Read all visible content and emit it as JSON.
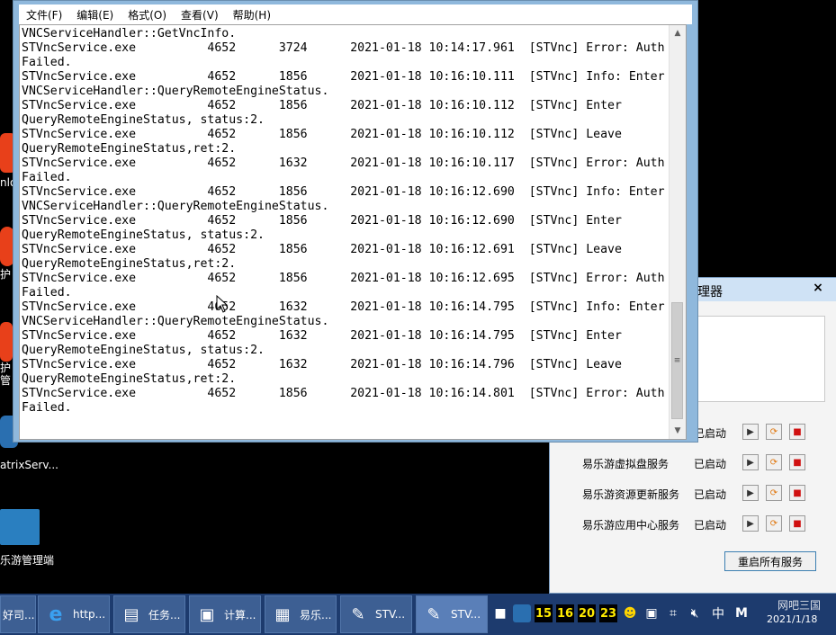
{
  "desktop": {
    "icons": [
      {
        "label": "nlo",
        "color": "#e8401a"
      },
      {
        "label": "护",
        "color": "#e8401a"
      },
      {
        "label": "护\n管",
        "color": "#e8401a"
      },
      {
        "label": "atrixServ...",
        "color": "#2a6fb0"
      },
      {
        "label": "乐游管理端",
        "color": "#2a7fc0"
      }
    ]
  },
  "notepad": {
    "menu": [
      "文件(F)",
      "编辑(E)",
      "格式(O)",
      "查看(V)",
      "帮助(H)"
    ],
    "log_lines": [
      "VNCServiceHandler::GetVncInfo.",
      "STVncService.exe          4652      3724      2021-01-18 10:14:17.961  [STVnc] Error: Auth",
      "Failed.",
      "STVncService.exe          4652      1856      2021-01-18 10:16:10.111  [STVnc] Info: Enter",
      "VNCServiceHandler::QueryRemoteEngineStatus.",
      "STVncService.exe          4652      1856      2021-01-18 10:16:10.112  [STVnc] Enter",
      "QueryRemoteEngineStatus, status:2.",
      "STVncService.exe          4652      1856      2021-01-18 10:16:10.112  [STVnc] Leave",
      "QueryRemoteEngineStatus,ret:2.",
      "STVncService.exe          4652      1632      2021-01-18 10:16:10.117  [STVnc] Error: Auth",
      "Failed.",
      "STVncService.exe          4652      1856      2021-01-18 10:16:12.690  [STVnc] Info: Enter",
      "VNCServiceHandler::QueryRemoteEngineStatus.",
      "STVncService.exe          4652      1856      2021-01-18 10:16:12.690  [STVnc] Enter",
      "QueryRemoteEngineStatus, status:2.",
      "STVncService.exe          4652      1856      2021-01-18 10:16:12.691  [STVnc] Leave",
      "QueryRemoteEngineStatus,ret:2.",
      "STVncService.exe          4652      1856      2021-01-18 10:16:12.695  [STVnc] Error: Auth",
      "Failed.",
      "STVncService.exe          4652      1632      2021-01-18 10:16:14.795  [STVnc] Info: Enter",
      "VNCServiceHandler::QueryRemoteEngineStatus.",
      "STVncService.exe          4652      1632      2021-01-18 10:16:14.795  [STVnc] Enter",
      "QueryRemoteEngineStatus, status:2.",
      "STVncService.exe          4652      1632      2021-01-18 10:16:14.796  [STVnc] Leave",
      "QueryRemoteEngineStatus,ret:2.",
      "STVncService.exe          4652      1856      2021-01-18 10:16:14.801  [STVnc] Error: Auth",
      "Failed."
    ]
  },
  "service_manager": {
    "title": "理器",
    "close": "×",
    "services": [
      {
        "name": "",
        "status": "已启动"
      },
      {
        "name": "易乐游虚拟盘服务",
        "status": "已启动"
      },
      {
        "name": "易乐游资源更新服务",
        "status": "已启动"
      },
      {
        "name": "易乐游应用中心服务",
        "status": "已启动"
      }
    ],
    "restart_all": "重启所有服务"
  },
  "taskbar": {
    "tasks": [
      {
        "label": "好司...",
        "icon": ""
      },
      {
        "label": "http...",
        "icon": "e"
      },
      {
        "label": "任务...",
        "icon": "▤"
      },
      {
        "label": "计算...",
        "icon": "▣"
      },
      {
        "label": "易乐...",
        "icon": "▦"
      },
      {
        "label": "STV...",
        "icon": "✎"
      },
      {
        "label": "STV...",
        "icon": "✎"
      }
    ],
    "tray_numbers": [
      "15",
      "16",
      "20",
      "23"
    ],
    "tray_ime": "中",
    "tray_m": "M",
    "clock_date": "2021/1/18",
    "watermark": "网吧三国"
  },
  "colors": {
    "desktop_bg": "#000000",
    "taskbar_bg": "#1d3b6e",
    "window_frame": "#8fb8dc",
    "tray_number_fg": "#ffea00"
  }
}
